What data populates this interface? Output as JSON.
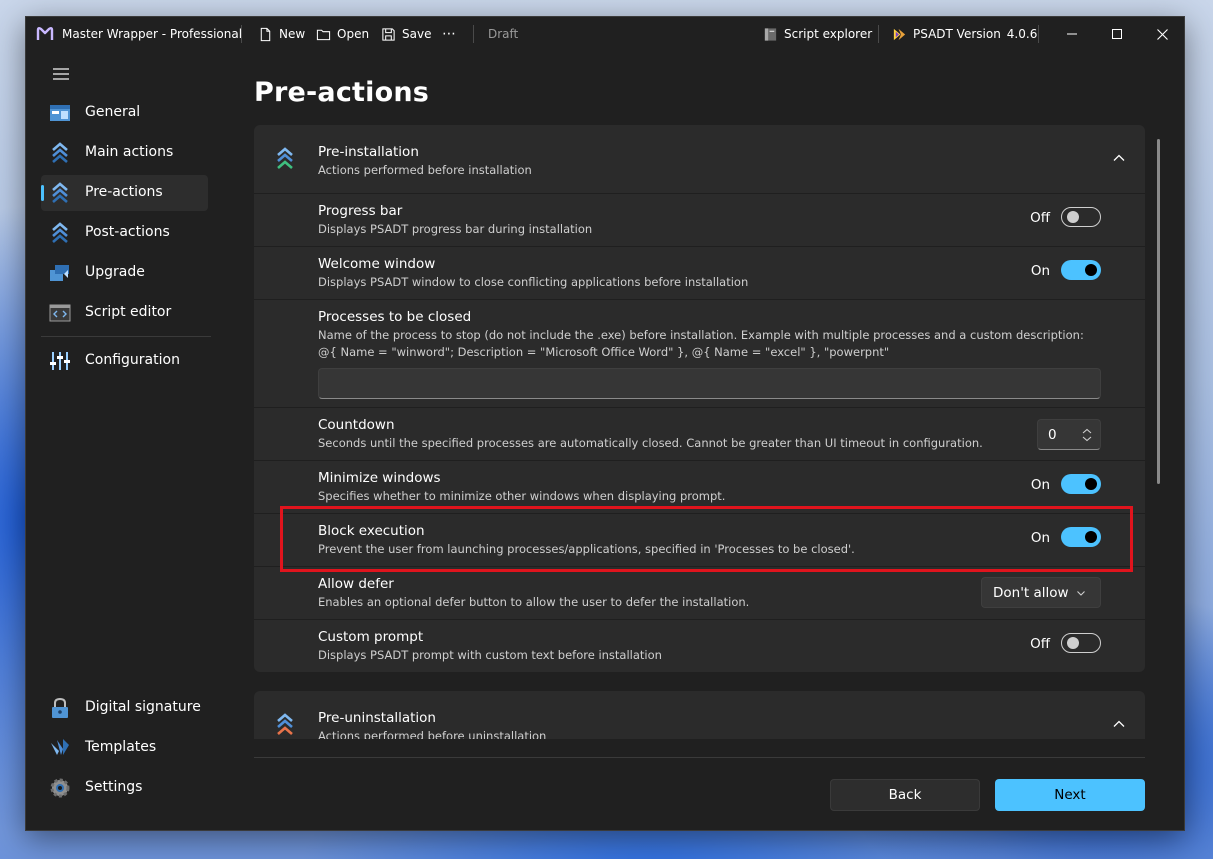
{
  "titlebar": {
    "app_title": "Master Wrapper - Professional",
    "new_label": "New",
    "open_label": "Open",
    "save_label": "Save",
    "more_label": "⋯",
    "draft_label": "Draft",
    "script_explorer_label": "Script explorer",
    "psadt_label": "PSADT Version",
    "psadt_version": "4.0.6"
  },
  "sidebar": {
    "items": [
      {
        "label": "General",
        "icon": "general-icon"
      },
      {
        "label": "Main actions",
        "icon": "chevrons-up-icon"
      },
      {
        "label": "Pre-actions",
        "icon": "chevrons-up-icon",
        "active": true
      },
      {
        "label": "Post-actions",
        "icon": "chevrons-up-icon"
      },
      {
        "label": "Upgrade",
        "icon": "upgrade-icon"
      },
      {
        "label": "Script editor",
        "icon": "code-window-icon"
      },
      {
        "label": "Configuration",
        "icon": "sliders-icon"
      }
    ],
    "bottom_items": [
      {
        "label": "Digital signature",
        "icon": "lock-icon"
      },
      {
        "label": "Templates",
        "icon": "templates-icon"
      },
      {
        "label": "Settings",
        "icon": "gear-icon"
      }
    ]
  },
  "page": {
    "title": "Pre-actions"
  },
  "pre_installation": {
    "title": "Pre-installation",
    "subtitle": "Actions performed before installation",
    "rows": {
      "progress_bar": {
        "title": "Progress bar",
        "description": "Displays PSADT progress bar during installation",
        "state": "Off"
      },
      "welcome_window": {
        "title": "Welcome window",
        "description": "Displays PSADT window to close conflicting applications before installation",
        "state": "On"
      },
      "processes": {
        "title": "Processes to be closed",
        "description_line1": "Name of the process to stop (do not include the .exe) before installation. Example with multiple processes and a custom description:",
        "description_line2": "@{ Name = \"winword\"; Description = \"Microsoft Office Word\" }, @{ Name = \"excel\" }, \"powerpnt\"",
        "value": ""
      },
      "countdown": {
        "title": "Countdown",
        "description": "Seconds until the specified processes are automatically closed. Cannot be greater than UI timeout in configuration.",
        "value": "0"
      },
      "minimize_windows": {
        "title": "Minimize windows",
        "description": "Specifies whether to minimize other windows when displaying prompt.",
        "state": "On"
      },
      "block_execution": {
        "title": "Block execution",
        "description": "Prevent the user from launching processes/applications, specified in 'Processes to be closed'.",
        "state": "On"
      },
      "allow_defer": {
        "title": "Allow defer",
        "description": "Enables an optional defer button to allow the user to defer the installation.",
        "value": "Don't allow"
      },
      "custom_prompt": {
        "title": "Custom prompt",
        "description": "Displays PSADT prompt with custom text before installation",
        "state": "Off"
      }
    }
  },
  "pre_uninstallation": {
    "title": "Pre-uninstallation",
    "subtitle": "Actions performed before uninstallation"
  },
  "footer": {
    "back_label": "Back",
    "next_label": "Next"
  },
  "colors": {
    "accent": "#4cc2ff",
    "highlight": "#e0141d",
    "window_bg": "#202020",
    "card_bg": "#2b2b2b"
  }
}
